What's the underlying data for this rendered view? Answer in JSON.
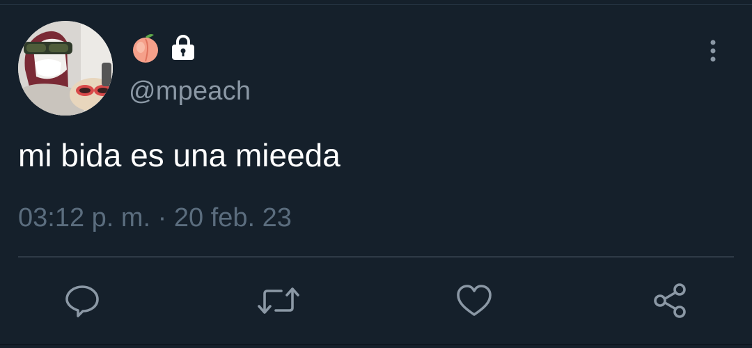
{
  "tweet": {
    "handle": "@mpeach",
    "name_emoji": "peach-emoji",
    "protected_icon": "lock-icon",
    "text": "mi bida es una mieeda",
    "time": "03:12 p. m.",
    "separator": " · ",
    "date": "20 feb. 23"
  },
  "actions": [
    "reply-icon",
    "retweet-icon",
    "like-icon",
    "share-icon"
  ],
  "colors": {
    "background": "#15202b",
    "text": "#ffffff",
    "secondary": "#8b98a5",
    "meta": "#5b6d7e",
    "icon": "#8b98a5",
    "divider": "#2f3b47"
  }
}
